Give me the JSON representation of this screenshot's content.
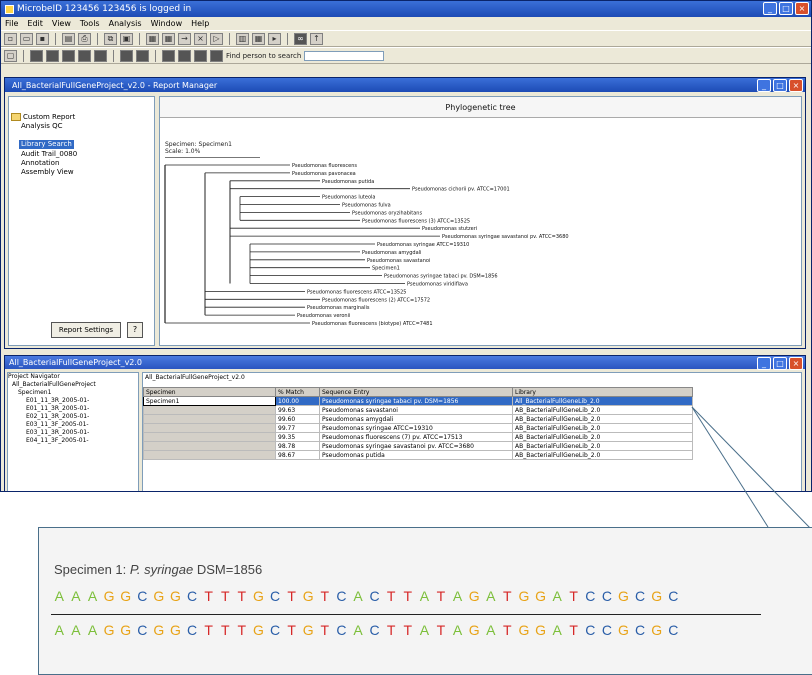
{
  "app": {
    "title": "MicrobeID    123456 123456 is logged in",
    "menu": [
      "File",
      "Edit",
      "View",
      "Tools",
      "Analysis",
      "Window",
      "Help"
    ],
    "toolbar_find_label": "Find person to search"
  },
  "report_window": {
    "title": "All_BacterialFullGeneProject_v2.0 - Report Manager",
    "tree": [
      "Custom Report",
      "Analysis QC",
      "Library Search",
      "Audit Trail_0080",
      "Annotation",
      "Assembly View"
    ],
    "selected_item": "Library Search",
    "report_settings_label": "Report Settings",
    "help_label": "?"
  },
  "phylo": {
    "title": "Phylogenetic tree",
    "specimen_label": "Specimen: Specimen1",
    "scale_label": "Scale: 1.0%",
    "taxa": [
      "Pseudomonas fluorescens",
      "Pseudomonas pavonacea",
      "Pseudomonas putida",
      "Pseudomonas cichorii pv. ATCC=17001",
      "Pseudomonas luteola",
      "Pseudomonas fulva",
      "Pseudomonas oryzihabitans",
      "Pseudomonas fluorescens (3) ATCC=13525",
      "Pseudomonas stutzeri",
      "Pseudomonas syringae savastanoi pv. ATCC=3680",
      "Pseudomonas syringae ATCC=19310",
      "Pseudomonas amygdali",
      "Pseudomonas savastanoi",
      "Specimen1",
      "Pseudomonas syringae tabaci pv. DSM=1856",
      "Pseudomonas viridiflava",
      "Pseudomonas fluorescens ATCC=13525",
      "Pseudomonas fluorescens (2) ATCC=17572",
      "Pseudomonas marginalis",
      "Pseudomonas veronii",
      "Pseudomonas fluorescens (biotype) ATCC=7481"
    ]
  },
  "seq_window": {
    "title": "All_BacterialFullGeneProject_v2.0",
    "tree": [
      "Project Navigator",
      "All_BacterialFullGeneProject",
      "Specimen1",
      "E01_11_3R_2005-01-",
      "E01_11_3R_2005-01-",
      "E02_11_3R_2005-01-",
      "E03_11_3F_2005-01-",
      "E03_11_3R_2005-01-",
      "E04_11_3F_2005-01-"
    ],
    "grid_label": "All_BacterialFullGeneProject_v2.0",
    "columns": [
      "Specimen",
      "% Match",
      "Sequence Entry",
      "Library"
    ],
    "rows": [
      [
        "Specimen1",
        "100.00",
        "Pseudomonas syringae tabaci pv. DSM=1856",
        "All_BacterialFullGeneLib_2.0"
      ],
      [
        "",
        "99.63",
        "Pseudomonas savastanoi",
        "AB_BacterialFullGeneLib_2.0"
      ],
      [
        "",
        "99.60",
        "Pseudomonas amygdali",
        "AB_BacterialFullGeneLib_2.0"
      ],
      [
        "",
        "99.77",
        "Pseudomonas syringae ATCC=19310",
        "AB_BacterialFullGeneLib_2.0"
      ],
      [
        "",
        "99.35",
        "Pseudomonas fluorescens (7) pv. ATCC=17513",
        "AB_BacterialFullGeneLib_2.0"
      ],
      [
        "",
        "98.78",
        "Pseudomonas syringae savastanoi pv. ATCC=3680",
        "AB_BacterialFullGeneLib_2.0"
      ],
      [
        "",
        "98.67",
        "Pseudomonas putida",
        "AB_BacterialFullGeneLib_2.0"
      ]
    ]
  },
  "callout": {
    "specimen_prefix": "Specimen 1: ",
    "specimen_italic": "P. syringae",
    "specimen_suffix": " DSM=1856",
    "sequence_top": "AAAGGCGGCTTTGCTGTCACTTATAGATGGATCCGCGC",
    "sequence_bottom": "AAAGGCGGCTTTGCTGTCACTTATAGATGGATCCGCGC",
    "base_colors": {
      "A": "#7cbf3a",
      "G": "#e8a317",
      "C": "#2a5ea8",
      "T": "#d62828"
    }
  }
}
